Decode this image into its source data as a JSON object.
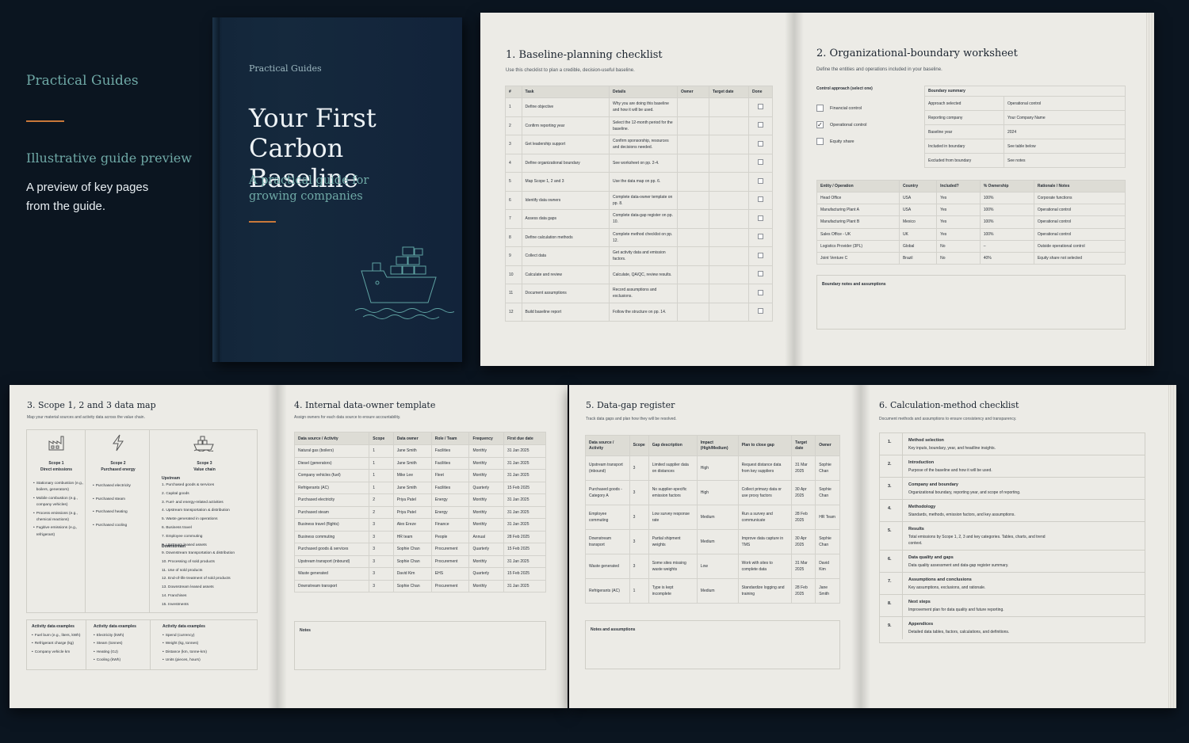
{
  "intro": {
    "brand": "Practical Guides",
    "subtitle": "Illustrative guide preview",
    "description": "A preview of key pages from the guide."
  },
  "book": {
    "series": "Practical Guides",
    "title": "Your First Carbon Baseline",
    "tagline": "A practical guide for growing companies"
  },
  "checklist": {
    "title": "1. Baseline-planning checklist",
    "subtitle": "Use this checklist to plan a credible, decision-useful baseline.",
    "headers": [
      "#",
      "Task",
      "Details",
      "Owner",
      "Target date",
      "Done"
    ],
    "rows": [
      [
        "1",
        "Define objective",
        "Why you are doing this baseline and how it will be used."
      ],
      [
        "2",
        "Confirm reporting year",
        "Select the 12-month period for the baseline."
      ],
      [
        "3",
        "Get leadership support",
        "Confirm sponsorship, resources and decisions needed."
      ],
      [
        "4",
        "Define organizational boundary",
        "See worksheet on pp. 2-4."
      ],
      [
        "5",
        "Map Scope 1, 2 and 3",
        "Use the data map on pp. 6."
      ],
      [
        "6",
        "Identify data owners",
        "Complete data-owner template on pp. 8."
      ],
      [
        "7",
        "Assess data gaps",
        "Complete data-gap register on pp. 10."
      ],
      [
        "8",
        "Define calculation methods",
        "Complete method checklist on pp. 12."
      ],
      [
        "9",
        "Collect data",
        "Get activity data and emission factors."
      ],
      [
        "10",
        "Calculate and review",
        "Calculate, QA/QC, review results."
      ],
      [
        "11",
        "Document assumptions",
        "Record assumptions and exclusions."
      ],
      [
        "12",
        "Build baseline report",
        "Follow the structure on pp. 14."
      ]
    ]
  },
  "boundary": {
    "title": "2. Organizational-boundary worksheet",
    "subtitle": "Define the entities and operations included in your baseline.",
    "control_label": "Control approach (select one)",
    "options": [
      "Financial control",
      "Operational control",
      "Equity share"
    ],
    "selected_option": "Operational control",
    "summary_title": "Boundary summary",
    "summary": [
      [
        "Approach selected",
        "Operational control"
      ],
      [
        "Reporting company",
        "Your Company Name"
      ],
      [
        "Baseline year",
        "2024"
      ],
      [
        "Included in boundary",
        "See table below"
      ],
      [
        "Excluded from boundary",
        "See notes"
      ]
    ],
    "headers": [
      "Entity / Operation",
      "Country",
      "Included?",
      "% Ownership",
      "Rationale / Notes"
    ],
    "rows": [
      [
        "Head Office",
        "USA",
        "Yes",
        "100%",
        "Corporate functions"
      ],
      [
        "Manufacturing Plant A",
        "USA",
        "Yes",
        "100%",
        "Operational control"
      ],
      [
        "Manufacturing Plant B",
        "Mexico",
        "Yes",
        "100%",
        "Operational control"
      ],
      [
        "Sales Office - UK",
        "UK",
        "Yes",
        "100%",
        "Operational control"
      ],
      [
        "Logistics Provider (3PL)",
        "Global",
        "No",
        "–",
        "Outside operational control"
      ],
      [
        "Joint Venture C",
        "Brazil",
        "No",
        "40%",
        "Equity share not selected"
      ]
    ],
    "notes_label": "Boundary notes and assumptions"
  },
  "datamap": {
    "title": "3. Scope 1, 2 and 3 data map",
    "subtitle": "Map your material sources and activity data across the value chain.",
    "scope1": {
      "title": "Scope 1",
      "subtitle": "Direct emissions",
      "items": [
        "Stationary combustion (e.g., boilers, generators)",
        "Mobile combustion (e.g., company vehicles)",
        "Process emissions (e.g., chemical reactions)",
        "Fugitive emissions (e.g., refrigerant)"
      ]
    },
    "scope2": {
      "title": "Scope 2",
      "subtitle": "Purchased energy",
      "items": [
        "Purchased electricity",
        "Purchased steam",
        "Purchased heating",
        "Purchased cooling"
      ]
    },
    "scope3": {
      "title": "Scope 3",
      "subtitle": "Value chain",
      "upstream_label": "Upstream",
      "downstream_label": "Downstream",
      "upstream": [
        "1. Purchased goods & services",
        "2. Capital goods",
        "3. Fuel- and energy-related activities",
        "4. Upstream transportation & distribution",
        "5. Waste generated in operations",
        "6. Business travel",
        "7. Employee commuting",
        "8. Upstream leased assets"
      ],
      "downstream": [
        "9. Downstream transportation & distribution",
        "10. Processing of sold products",
        "11. Use of sold products",
        "12. End-of-life treatment of sold products",
        "13. Downstream leased assets",
        "14. Franchises",
        "15. Investments"
      ]
    },
    "activity_label": "Activity data examples",
    "activity1": [
      "Fuel burn (e.g., liters, kWh)",
      "Refrigerant charge (kg)",
      "Company vehicle km"
    ],
    "activity2": [
      "Electricity (kWh)",
      "Steam (tonnes)",
      "Heating (GJ)",
      "Cooling (kWh)"
    ],
    "activity3": [
      "Spend (currency)",
      "Weight (kg, tonnes)",
      "Distance (km, tonne-km)",
      "Units (pieces, hours)"
    ]
  },
  "owners": {
    "title": "4. Internal data-owner template",
    "subtitle": "Assign owners for each data source to ensure accountability.",
    "headers": [
      "Data source / Activity",
      "Scope",
      "Data owner",
      "Role / Team",
      "Frequency",
      "First due date"
    ],
    "rows": [
      [
        "Natural gas (boilers)",
        "1",
        "Jane Smith",
        "Facilities",
        "Monthly",
        "31 Jan 2025"
      ],
      [
        "Diesel (generators)",
        "1",
        "Jane Smith",
        "Facilities",
        "Monthly",
        "31 Jan 2025"
      ],
      [
        "Company vehicles (fuel)",
        "1",
        "Mike Lee",
        "Fleet",
        "Monthly",
        "31 Jan 2025"
      ],
      [
        "Refrigerants (AC)",
        "1",
        "Jane Smith",
        "Facilities",
        "Quarterly",
        "15 Feb 2025"
      ],
      [
        "Purchased electricity",
        "2",
        "Priya Patel",
        "Energy",
        "Monthly",
        "31 Jan 2025"
      ],
      [
        "Purchased steam",
        "2",
        "Priya Patel",
        "Energy",
        "Monthly",
        "31 Jan 2025"
      ],
      [
        "Business travel (flights)",
        "3",
        "Alex Ereze",
        "Finance",
        "Monthly",
        "31 Jan 2025"
      ],
      [
        "Business commuting",
        "3",
        "HR team",
        "People",
        "Annual",
        "28 Feb 2025"
      ],
      [
        "Purchased goods & services",
        "3",
        "Sophie Chan",
        "Procurement",
        "Quarterly",
        "15 Feb 2025"
      ],
      [
        "Upstream transport (inbound)",
        "3",
        "Sophie Chan",
        "Procurement",
        "Monthly",
        "31 Jan 2025"
      ],
      [
        "Waste generated",
        "3",
        "David Kim",
        "EHS",
        "Quarterly",
        "15 Feb 2025"
      ],
      [
        "Downstream transport",
        "3",
        "Sophie Chan",
        "Procurement",
        "Monthly",
        "31 Jan 2025"
      ]
    ],
    "notes_label": "Notes"
  },
  "gaps": {
    "title": "5. Data-gap register",
    "subtitle": "Track data gaps and plan how they will be resolved.",
    "headers": [
      "Data source / Activity",
      "Scope",
      "Gap description",
      "Impact (High/Medium)",
      "Plan to close gap",
      "Target date",
      "Owner"
    ],
    "rows": [
      [
        "Upstream transport (inbound)",
        "3",
        "Limited supplier data on distances",
        "High",
        "Request distance data from key suppliers",
        "31 Mar 2025",
        "Sophie Chan"
      ],
      [
        "Purchased goods - Category A",
        "3",
        "No supplier-specific emission factors",
        "High",
        "Collect primary data or use proxy factors",
        "30 Apr 2025",
        "Sophie Chan"
      ],
      [
        "Employee commuting",
        "3",
        "Low survey response rate",
        "Medium",
        "Run a survey and communicate",
        "28 Feb 2025",
        "HR Team"
      ],
      [
        "Downstream transport",
        "3",
        "Partial shipment weights",
        "Medium",
        "Improve data capture in TMS",
        "30 Apr 2025",
        "Sophie Chan"
      ],
      [
        "Waste generated",
        "3",
        "Some sites missing waste weights",
        "Low",
        "Work with sites to complete data",
        "31 Mar 2025",
        "David Kim"
      ],
      [
        "Refrigerants (AC)",
        "1",
        "Type is kept incomplete",
        "Medium",
        "Standardize logging and training",
        "28 Feb 2025",
        "Jane Smith"
      ]
    ],
    "notes_label": "Notes and assumptions"
  },
  "methods": {
    "title": "6. Calculation-method checklist",
    "subtitle": "Document methods and assumptions to ensure consistency and transparency.",
    "items": [
      [
        "1.",
        "Method selection",
        "Key inputs, boundary, year, and headline insights."
      ],
      [
        "2.",
        "Introduction",
        "Purpose of the baseline and how it will be used."
      ],
      [
        "3.",
        "Company and boundary",
        "Organizational boundary, reporting year, and scope of reporting."
      ],
      [
        "4.",
        "Methodology",
        "Standards, methods, emission factors, and key assumptions."
      ],
      [
        "5.",
        "Results",
        "Total emissions by Scope 1, 2, 3 and key categories. Tables, charts, and trend context."
      ],
      [
        "6.",
        "Data quality and gaps",
        "Data quality assessment and data-gap register summary."
      ],
      [
        "7.",
        "Assumptions and conclusions",
        "Key assumptions, exclusions, and rationale."
      ],
      [
        "8.",
        "Next steps",
        "Improvement plan for data quality and future reporting."
      ],
      [
        "9.",
        "Appendices",
        "Detailed data tables, factors, calculations, and definitions."
      ]
    ]
  }
}
